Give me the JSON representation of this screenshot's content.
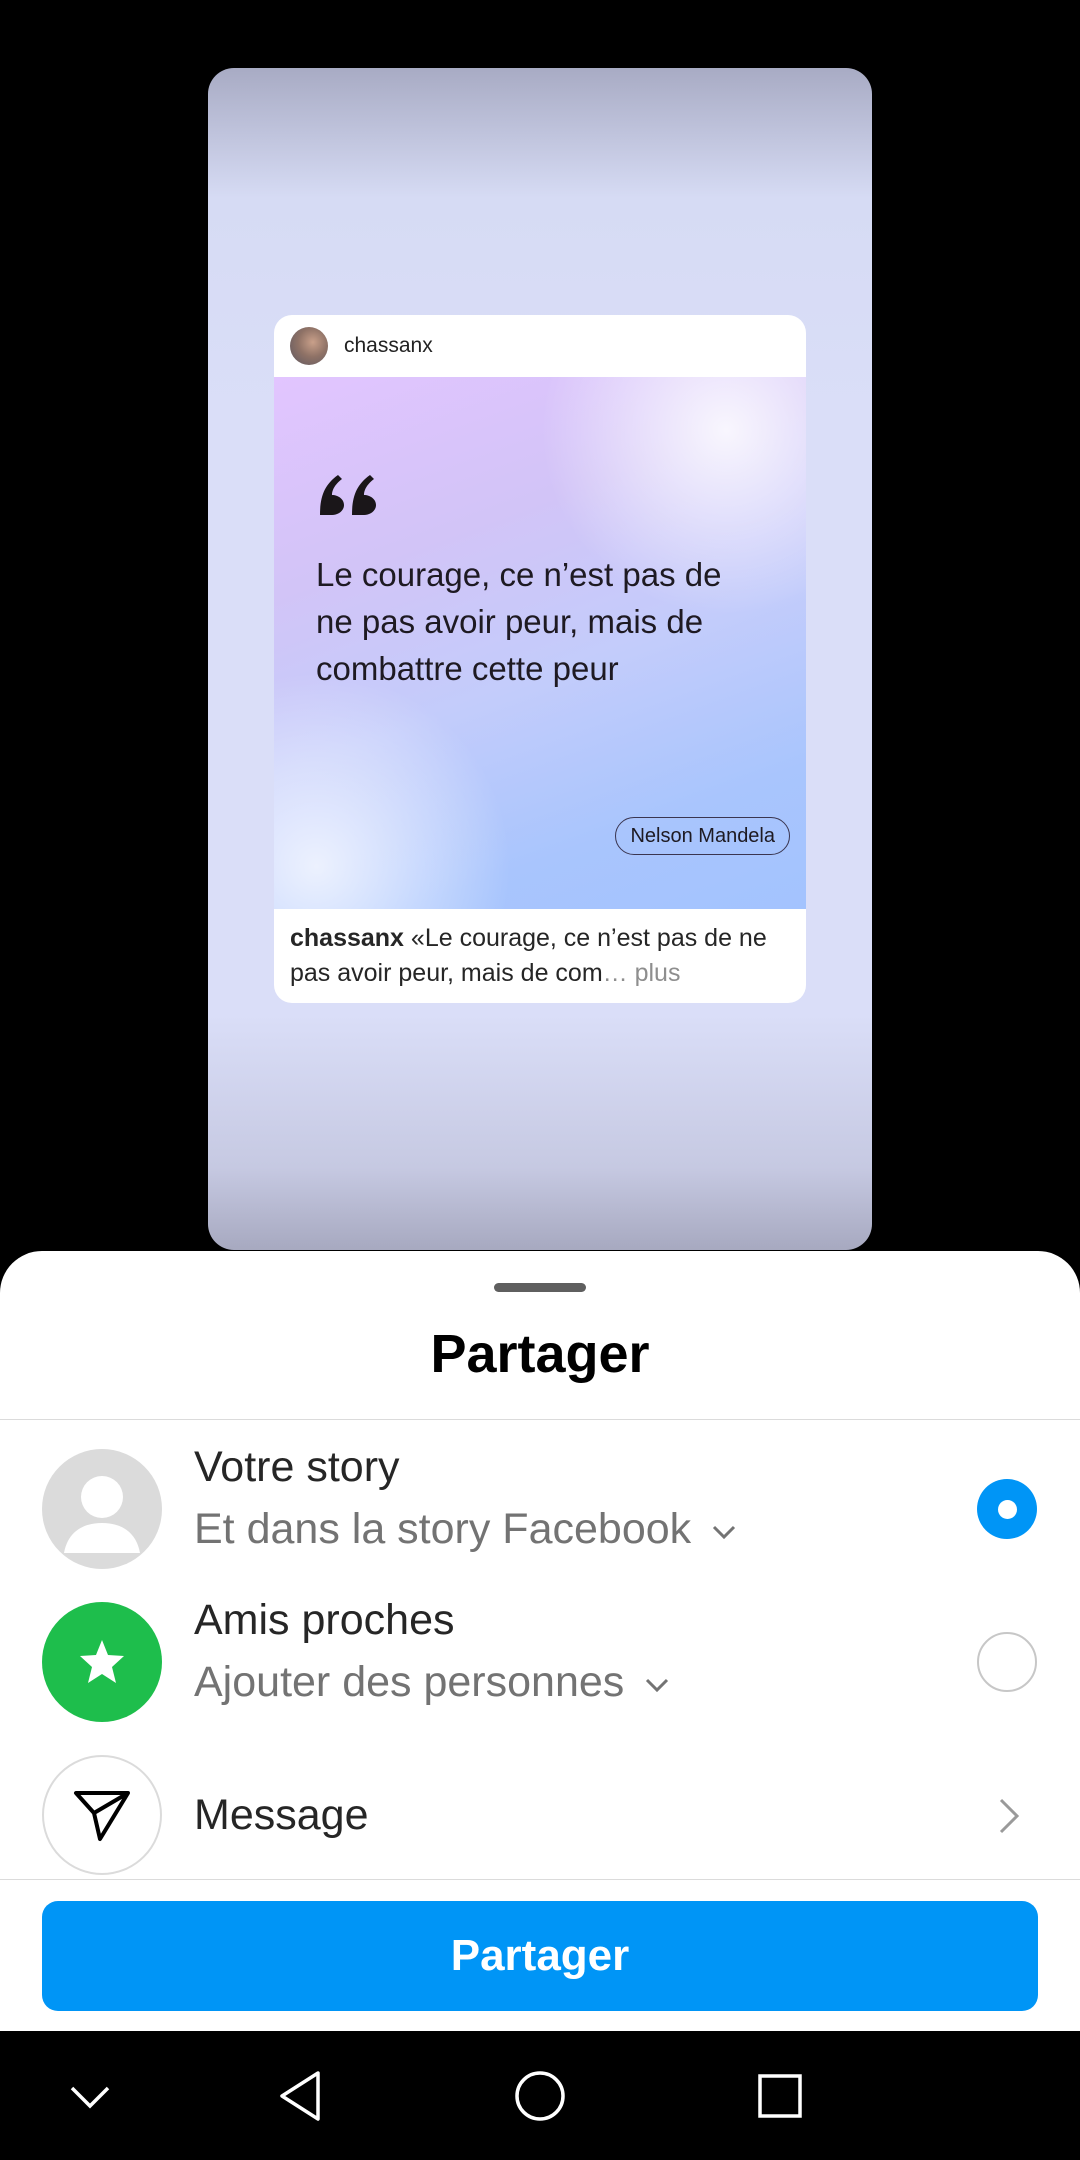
{
  "story_preview": {
    "post": {
      "username": "chassanx",
      "quote_text": "Le courage, ce n’est pas de ne pas avoir peur, mais de combattre cette peur",
      "quote_author": "Nelson Mandela",
      "caption_username": "chassanx",
      "caption_text": " «Le courage, ce n’est pas de ne pas avoir peur, mais de com",
      "caption_ellipsis": "… plus"
    },
    "colors": {
      "backdrop": "#dadef8",
      "quote_gradient_start": "#e2c5ff",
      "quote_gradient_end": "#a3c3fe"
    }
  },
  "share_sheet": {
    "title": "Partager",
    "options": [
      {
        "icon": "person-icon",
        "title": "Votre story",
        "subtitle": "Et dans la story Facebook",
        "selected": true
      },
      {
        "icon": "star-icon",
        "title": "Amis proches",
        "subtitle": "Ajouter des personnes",
        "selected": false
      },
      {
        "icon": "paper-plane-icon",
        "title": "Message"
      }
    ],
    "share_button_label": "Partager",
    "colors": {
      "accent": "#0095f6",
      "close_friends": "#1ebe4c"
    }
  },
  "nav_bar": {
    "buttons": [
      "chevron-down-icon",
      "back-icon",
      "home-icon",
      "recents-icon"
    ]
  }
}
